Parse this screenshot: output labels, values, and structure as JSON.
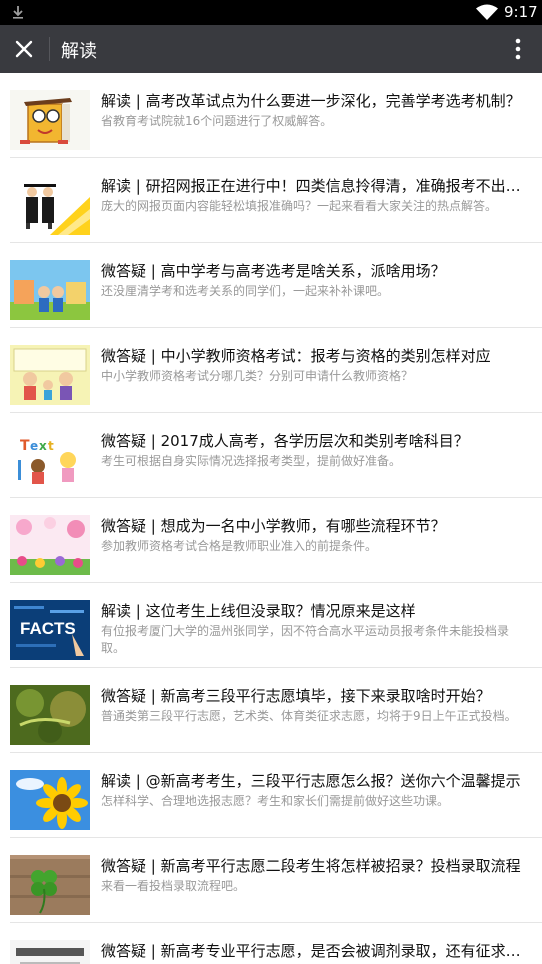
{
  "status_bar": {
    "time": "9:17"
  },
  "app_bar": {
    "title": "解读"
  },
  "articles": [
    {
      "title": "解读 | 高考改革试点为什么要进一步深化，完善学考选考机制？",
      "desc": "省教育考试院就16个问题进行了权威解答。",
      "thumb": "cartoon-book"
    },
    {
      "title": "解读 | 研招网报正在进行中！四类信息拎得清，准确报考不出错！",
      "desc": "庞大的网报页面内容能轻松填报准确吗？一起来看看大家关注的热点解答。",
      "thumb": "graduates"
    },
    {
      "title": "微答疑 | 高中学考与高考选考是啥关系，派啥用场？",
      "desc": "还没厘清学考和选考关系的同学们，一起来补补课吧。",
      "thumb": "school-kids"
    },
    {
      "title": "微答疑 | 中小学教师资格考试：报考与资格的类别怎样对应",
      "desc": "中小学教师资格考试分哪几类？分别可申请什么教师资格？",
      "thumb": "students-cartoon"
    },
    {
      "title": "微答疑 | 2017成人高考，各学历层次和类别考啥科目？",
      "desc": "考生可根据自身实际情况选择报考类型，提前做好准备。",
      "thumb": "text-kids"
    },
    {
      "title": "微答疑 | 想成为一名中小学教师，有哪些流程环节？",
      "desc": "参加教师资格考试合格是教师职业准入的前提条件。",
      "thumb": "flowers"
    },
    {
      "title": "解读 | 这位考生上线但没录取？情况原来是这样",
      "desc": "有位报考厦门大学的温州张同学，因不符合高水平运动员报考条件未能投档录取。",
      "thumb": "facts"
    },
    {
      "title": "微答疑 | 新高考三段平行志愿填毕，接下来录取啥时开始？",
      "desc": "普通类第三段平行志愿，艺术类、体育类征求志愿，均将于9日上午正式投档。",
      "thumb": "green-bokeh"
    },
    {
      "title": "解读 | @新高考考生，三段平行志愿怎么报？送你六个温馨提示",
      "desc": "怎样科学、合理地选报志愿？考生和家长们需提前做好这些功课。",
      "thumb": "sunflower"
    },
    {
      "title": "微答疑 | 新高考平行志愿二段考生将怎样被招录？投档录取流程",
      "desc": "来看一看投档录取流程吧。",
      "thumb": "clover"
    },
    {
      "title": "微答疑 | 新高考专业平行志愿，是否会被调剂录取，还有征求志愿吗？",
      "desc": "",
      "thumb": "document"
    }
  ]
}
